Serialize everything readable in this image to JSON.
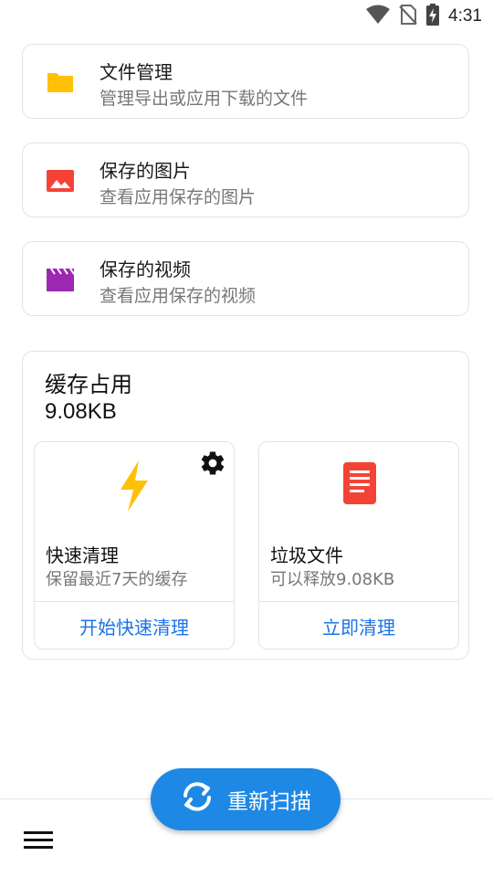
{
  "status_bar": {
    "time": "4:31",
    "icons": [
      "wifi-icon",
      "no-sim-icon",
      "battery-charging-icon"
    ]
  },
  "items": [
    {
      "title": "文件管理",
      "subtitle": "管理导出或应用下载的文件",
      "icon": "folder-icon",
      "color": "#FFC107"
    },
    {
      "title": "保存的图片",
      "subtitle": "查看应用保存的图片",
      "icon": "image-icon",
      "color": "#F44336"
    },
    {
      "title": "保存的视频",
      "subtitle": "查看应用保存的视频",
      "icon": "video-clapper-icon",
      "color": "#9C27B0"
    }
  ],
  "cache": {
    "title": "缓存占用",
    "size": "9.08KB",
    "quick_clean": {
      "title": "快速清理",
      "description": "保留最近7天的缓存",
      "action": "开始快速清理",
      "icon": "lightning-icon",
      "settings_icon": "gear-icon",
      "color": "#FFC107"
    },
    "junk_files": {
      "title": "垃圾文件",
      "description": "可以释放9.08KB",
      "action": "立即清理",
      "icon": "document-icon",
      "color": "#F44336"
    }
  },
  "fab": {
    "label": "重新扫描",
    "icon": "refresh-icon"
  },
  "bottom_bar": {
    "menu_icon": "menu-icon"
  },
  "accent_color": "#1E88E5"
}
